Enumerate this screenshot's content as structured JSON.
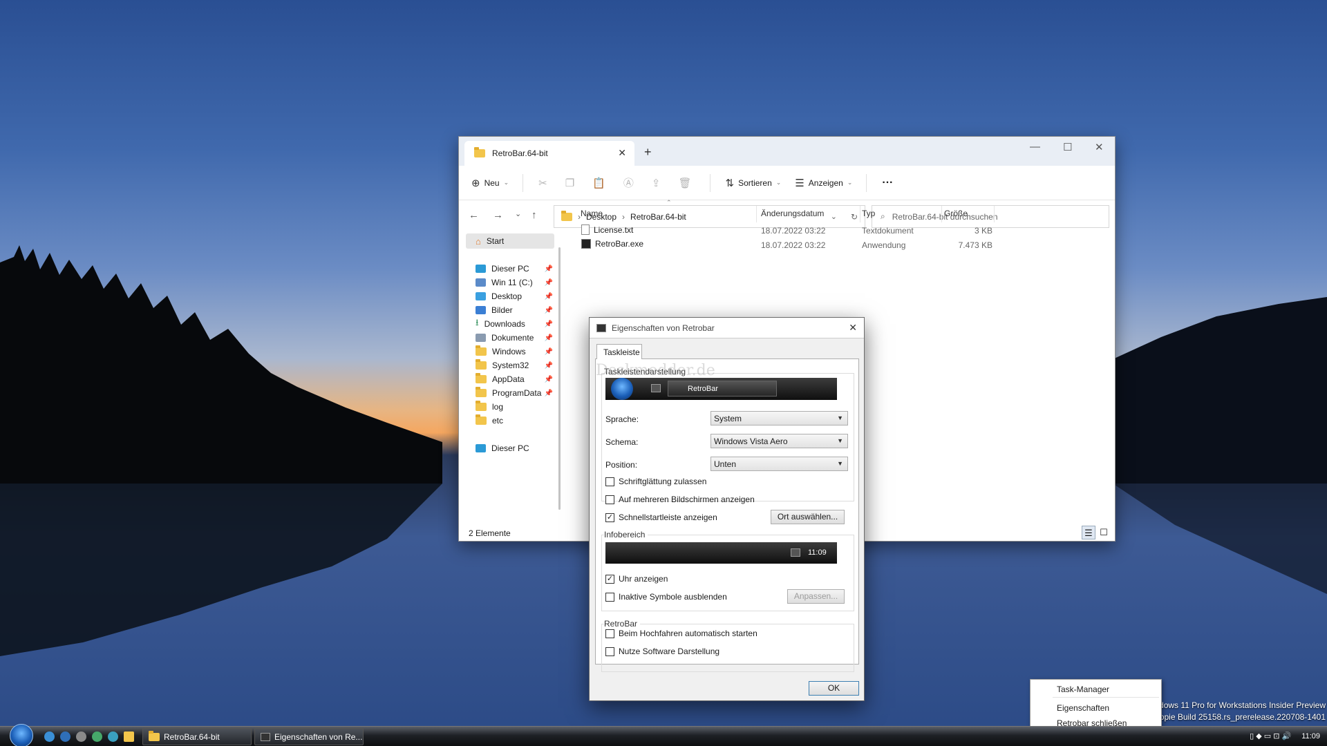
{
  "desktop": {
    "watermark_line1": "dows 11 Pro for Workstations Insider Preview",
    "watermark_line2": "skopie Build 25158.rs_prerelease.220708-1401"
  },
  "explorer": {
    "tab_title": "RetroBar.64-bit",
    "tab_close": "✕",
    "new_tab": "+",
    "window_controls": {
      "minimize": "—",
      "maximize": "☐",
      "close": "✕"
    },
    "commands": {
      "new": "Neu",
      "sort": "Sortieren",
      "view": "Anzeigen",
      "more": "···"
    },
    "breadcrumb": [
      "Desktop",
      "RetroBar.64-bit"
    ],
    "search_placeholder": "RetroBar.64-bit durchsuchen",
    "nav": [
      {
        "label": "Start"
      },
      {
        "label": "Dieser PC"
      },
      {
        "label": "Win 11 (C:)"
      },
      {
        "label": "Desktop"
      },
      {
        "label": "Bilder"
      },
      {
        "label": "Downloads"
      },
      {
        "label": "Dokumente"
      },
      {
        "label": "Windows"
      },
      {
        "label": "System32"
      },
      {
        "label": "AppData"
      },
      {
        "label": "ProgramData"
      },
      {
        "label": "log"
      },
      {
        "label": "etc"
      },
      {
        "label": "Dieser PC"
      }
    ],
    "columns": {
      "name": "Name",
      "date": "Änderungsdatum",
      "type": "Typ",
      "size": "Größe"
    },
    "files": [
      {
        "name": "License.txt",
        "date": "18.07.2022 03:22",
        "type": "Textdokument",
        "size": "3 KB"
      },
      {
        "name": "RetroBar.exe",
        "date": "18.07.2022 03:22",
        "type": "Anwendung",
        "size": "7.473 KB"
      }
    ],
    "status": "2 Elemente"
  },
  "dialog": {
    "title": "Eigenschaften von Retrobar",
    "tab": "Taskleiste",
    "group_taskbar": "Taskleistendarstellung",
    "preview_button": "RetroBar",
    "language_label": "Sprache:",
    "language_value": "System",
    "theme_label": "Schema:",
    "theme_value": "Windows Vista Aero",
    "position_label": "Position:",
    "position_value": "Unten",
    "cb_fontsmoothing": "Schriftglättung zulassen",
    "cb_multimon": "Auf mehreren Bildschirmen anzeigen",
    "cb_quicklaunch": "Schnellstartleiste anzeigen",
    "btn_location": "Ort auswählen...",
    "group_tray": "Infobereich",
    "tray_clock": "11:09",
    "cb_clock": "Uhr anzeigen",
    "cb_hideinactive": "Inaktive Symbole ausblenden",
    "btn_customize": "Anpassen...",
    "group_retrobar": "RetroBar",
    "cb_autostart": "Beim Hochfahren automatisch starten",
    "cb_software": "Nutze Software Darstellung",
    "ok": "OK",
    "check_mark": "✓",
    "watermark": "Deskmodder.de"
  },
  "taskbar": {
    "button1": "RetroBar.64-bit",
    "button2": "Eigenschaften von Re...",
    "clock": "11:09"
  },
  "context_menu": {
    "item1": "Task-Manager",
    "item2": "Eigenschaften",
    "item3": "Retrobar schließen"
  }
}
